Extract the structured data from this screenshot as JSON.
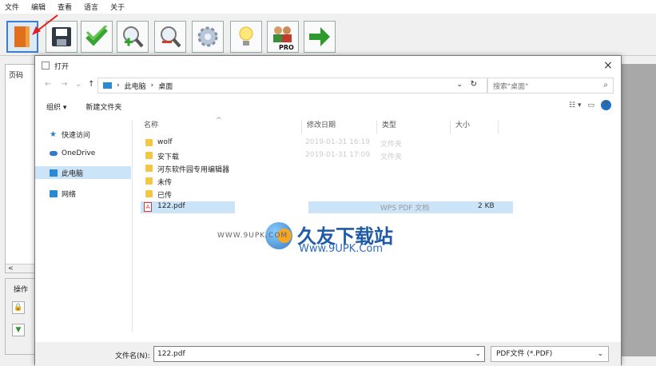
{
  "menu": [
    "文件",
    "编辑",
    "查看",
    "语言",
    "关于"
  ],
  "toolbar_icons": [
    "open-icon",
    "save-icon",
    "check-icon",
    "zoom-in-icon",
    "zoom-out-icon",
    "settings-icon",
    "tip-icon",
    "pro-users-icon",
    "next-arrow-icon"
  ],
  "toolbar_pro_badge": "PRO",
  "left_panel": {
    "title": "页码",
    "scroll": "<"
  },
  "ops": {
    "title": "操作"
  },
  "dialog": {
    "title": "打开",
    "close": "×",
    "address": [
      "此电脑",
      "›",
      "桌面"
    ],
    "address_sep": "›",
    "refresh": "↻",
    "search_placeholder": "搜索\"桌面\"",
    "cmd_organize": "组织 ▾",
    "cmd_new_folder": "新建文件夹",
    "help": "?",
    "nav": {
      "quick": "快速访问",
      "onedrive": "OneDrive",
      "thispc": "此电脑",
      "network": "网络"
    },
    "columns": {
      "name": "名称",
      "date": "修改日期",
      "type": "类型",
      "size": "大小"
    },
    "files": [
      {
        "name": "wolf",
        "date": "2019-01-31 16:19",
        "type": "文件夹",
        "size": ""
      },
      {
        "name": "安下载",
        "date": "2019-01-31 17:09",
        "type": "文件夹",
        "size": ""
      },
      {
        "name": "河东软件园专用编辑器",
        "date": "",
        "type": "",
        "size": ""
      },
      {
        "name": "未传",
        "date": "",
        "type": "",
        "size": ""
      },
      {
        "name": "已传",
        "date": "",
        "type": "",
        "size": ""
      }
    ],
    "pdf": {
      "name": "122.pdf",
      "type": "WPS PDF 文档",
      "size": "2 KB"
    },
    "filename_label": "文件名(N):",
    "filename_value": "122.pdf",
    "filetype_value": "PDF文件 (*.PDF)"
  },
  "watermark": {
    "small": "WWW.9UPK.COM",
    "big": "久友下载站",
    "url": "Www.9UPK.Com"
  }
}
